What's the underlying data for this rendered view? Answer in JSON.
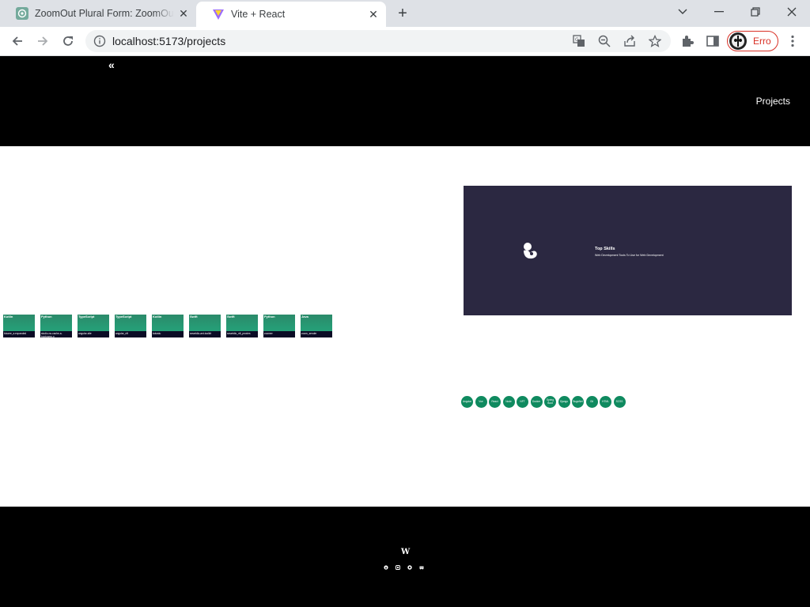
{
  "browser": {
    "tabs": [
      {
        "title": "ZoomOut Plural Form: ZoomOuts",
        "favicon": "chatgpt-icon",
        "active": false
      },
      {
        "title": "Vite + React",
        "favicon": "vite-icon",
        "active": true
      }
    ],
    "url": "localhost:5173/projects",
    "profile_label": "Erro"
  },
  "header": {
    "collapse_symbol": "«",
    "nav_projects": "Projects"
  },
  "projects": [
    {
      "language": "Kotlin",
      "name": "bizarre_a.expanded"
    },
    {
      "language": "Python",
      "name": "studio-no-cache-a-bootcamp-p"
    },
    {
      "language": "TypeScript",
      "name": "angular-site"
    },
    {
      "language": "TypeScript",
      "name": "angular_nft"
    },
    {
      "language": "Kotlin",
      "name": "kotostu"
    },
    {
      "language": "Swift",
      "name": "smartdio-ant-toolkit"
    },
    {
      "language": "Swift",
      "name": "smartdio_nft_proxies"
    },
    {
      "language": "Python",
      "name": "zoomer"
    },
    {
      "language": "Java",
      "name": "zoom_sender"
    }
  ],
  "skills_panel": {
    "title": "Top Skills",
    "subtitle": "Web Development Tools To Use for Web Development"
  },
  "skills": [
    "Angular",
    "Vue",
    "React",
    "Node",
    "NFT",
    "Docker",
    "Spring Boot",
    "Django",
    "BugsNet",
    "Git",
    "HTML",
    "SCSS"
  ],
  "footer": {
    "logo": "W",
    "icons": [
      "linkedin-icon",
      "instagram-icon",
      "github-icon",
      "discord-icon"
    ]
  },
  "colors": {
    "header_bg": "#000000",
    "panel_bg": "#2b2841",
    "card_green": "#25a078",
    "skill_green": "#0f8a5f",
    "profile_red": "#d93025"
  }
}
